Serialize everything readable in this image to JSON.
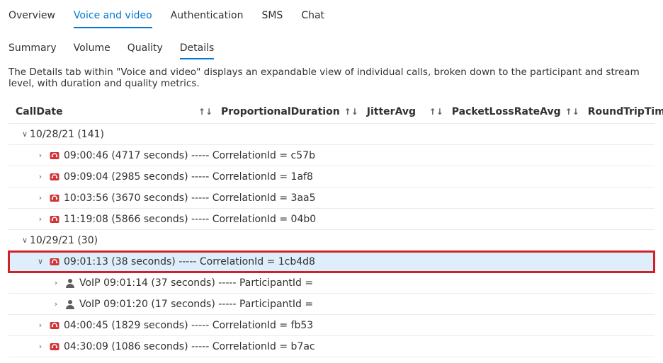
{
  "mainTabs": {
    "overview": "Overview",
    "voiceVideo": "Voice and video",
    "authentication": "Authentication",
    "sms": "SMS",
    "chat": "Chat",
    "active": "voiceVideo"
  },
  "subTabs": {
    "summary": "Summary",
    "volume": "Volume",
    "quality": "Quality",
    "details": "Details",
    "active": "details"
  },
  "description": "The Details tab within \"Voice and video\" displays an expandable view of individual calls, broken down to the participant and stream level, with duration and quality metrics.",
  "columns": {
    "callDate": "CallDate",
    "propDuration": "ProportionalDuration",
    "jitter": "JitterAvg",
    "packetLoss": "PacketLossRateAvg",
    "rtt": "RoundTripTimeAvg"
  },
  "sortGlyph": "↑↓",
  "groups": [
    {
      "label": "10/28/21 (141)",
      "expanded": true,
      "calls": [
        {
          "text": "09:00:46 (4717 seconds) ----- CorrelationId = c57b",
          "expanded": false
        },
        {
          "text": "09:09:04 (2985 seconds) ----- CorrelationId = 1af8",
          "expanded": false
        },
        {
          "text": "10:03:56 (3670 seconds) ----- CorrelationId = 3aa5",
          "expanded": false
        },
        {
          "text": "11:19:08 (5866 seconds) ----- CorrelationId = 04b0",
          "expanded": false
        }
      ]
    },
    {
      "label": "10/29/21 (30)",
      "expanded": true,
      "calls": [
        {
          "text": "09:01:13 (38 seconds) ----- CorrelationId = 1cb4d8",
          "expanded": true,
          "highlight": true,
          "participants": [
            {
              "text": "VoIP 09:01:14 (37 seconds) ----- ParticipantId ="
            },
            {
              "text": "VoIP 09:01:20 (17 seconds) ----- ParticipantId ="
            }
          ]
        },
        {
          "text": "04:00:45 (1829 seconds) ----- CorrelationId = fb53",
          "expanded": false
        },
        {
          "text": "04:30:09 (1086 seconds) ----- CorrelationId = b7ac",
          "expanded": false
        }
      ]
    }
  ]
}
